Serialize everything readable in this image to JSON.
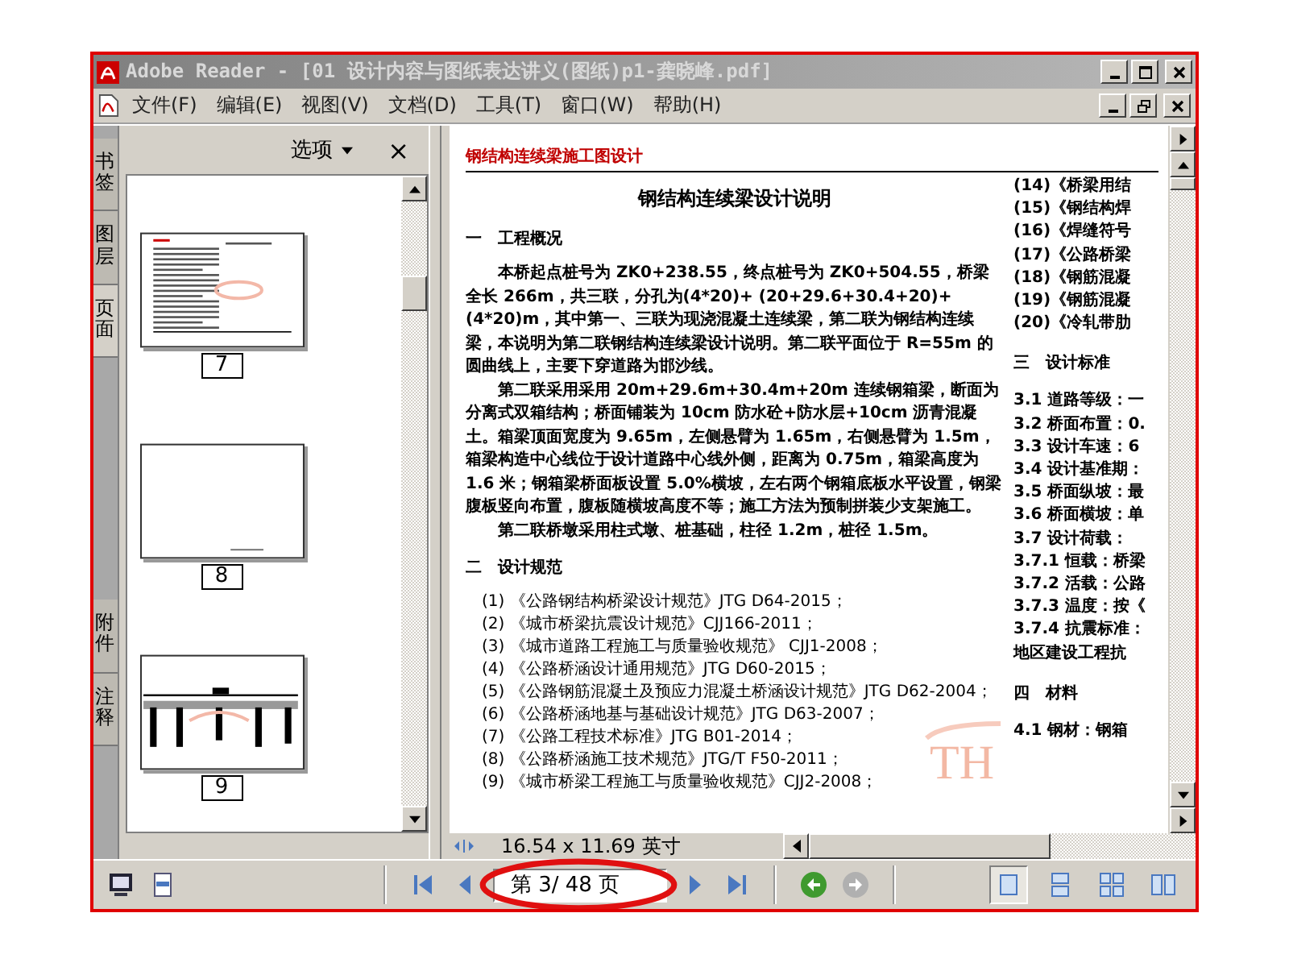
{
  "window": {
    "title": "Adobe Reader - [01 设计内容与图纸表达讲义(图纸)p1-龚晓峰.pdf]"
  },
  "menu": [
    "文件(F)",
    "编辑(E)",
    "视图(V)",
    "文档(D)",
    "工具(T)",
    "窗口(W)",
    "帮助(H)"
  ],
  "side_tabs": [
    {
      "label": "书签",
      "selected": false
    },
    {
      "label": "图层",
      "selected": false
    },
    {
      "label": "页面",
      "selected": true
    },
    {
      "label": "附件",
      "selected": false
    },
    {
      "label": "注释",
      "selected": false
    }
  ],
  "panel": {
    "options": "选项",
    "close": "×"
  },
  "thumbnails": [
    {
      "page": "7",
      "kind": "text"
    },
    {
      "page": "8",
      "kind": "blank"
    },
    {
      "page": "9",
      "kind": "drawing"
    }
  ],
  "document": {
    "header": "钢结构连续梁施工图设计",
    "title": "钢结构连续梁设计说明",
    "logo_text": "TH",
    "left_column": [
      {
        "kind": "heading",
        "text": "一　工程概况"
      },
      {
        "kind": "paragraph",
        "text": "本桥起点桩号为 ZK0+238.55，终点桩号为 ZK0+504.55，桥梁全长 266m，共三联，分孔为(4*20)+ (20+29.6+30.4+20)+(4*20)m，其中第一、三联为现浇混凝土连续梁，第二联为钢结构连续梁，本说明为第二联钢结构连续梁设计说明。第二联平面位于 R=55m 的圆曲线上，主要下穿道路为邯沙线。"
      },
      {
        "kind": "paragraph",
        "text": "第二联采用采用 20m+29.6m+30.4m+20m 连续钢箱梁，断面为分离式双箱结构；桥面铺装为 10cm 防水砼+防水层+10cm 沥青混凝土。箱梁顶面宽度为 9.65m，左侧悬臂为 1.65m，右侧悬臂为 1.5m，箱梁构造中心线位于设计道路中心线外侧，距离为 0.75m，箱梁高度为 1.6 米；钢箱梁桥面板设置 5.0%横坡，左右两个钢箱底板水平设置，钢梁腹板竖向布置，腹板随横坡高度不等；施工方法为预制拼装少支架施工。"
      },
      {
        "kind": "paragraph",
        "text": "第二联桥墩采用柱式墩、桩基础，柱径 1.2m，桩径 1.5m。"
      },
      {
        "kind": "heading",
        "text": "二　设计规范"
      },
      {
        "kind": "item",
        "text": "(1) 《公路钢结构桥梁设计规范》JTG D64-2015；"
      },
      {
        "kind": "item",
        "text": "(2) 《城市桥梁抗震设计规范》CJJ166-2011；"
      },
      {
        "kind": "item",
        "text": "(3) 《城市道路工程施工与质量验收规范》 CJJ1-2008；"
      },
      {
        "kind": "item",
        "text": "(4) 《公路桥涵设计通用规范》JTG D60-2015；"
      },
      {
        "kind": "item",
        "text": "(5) 《公路钢筋混凝土及预应力混凝土桥涵设计规范》JTG D62-2004；"
      },
      {
        "kind": "item",
        "text": "(6) 《公路桥涵地基与基础设计规范》JTG D63-2007；"
      },
      {
        "kind": "item",
        "text": "(7) 《公路工程技术标准》JTG B01-2014；"
      },
      {
        "kind": "item",
        "text": "(8) 《公路桥涵施工技术规范》JTG/T F50-2011；"
      },
      {
        "kind": "item",
        "text": "(9) 《城市桥梁工程施工与质量验收规范》CJJ2-2008；"
      }
    ],
    "right_column": [
      {
        "kind": "item",
        "text": "(14)《桥梁用结"
      },
      {
        "kind": "item",
        "text": "(15)《钢结构焊"
      },
      {
        "kind": "item",
        "text": "(16)《焊缝符号"
      },
      {
        "kind": "item",
        "text": "(17)《公路桥梁"
      },
      {
        "kind": "item",
        "text": "(18)《钢筋混凝"
      },
      {
        "kind": "item",
        "text": "(19)《钢筋混凝"
      },
      {
        "kind": "item",
        "text": "(20)《冷轧带肋"
      },
      {
        "kind": "heading",
        "text": "三　设计标准"
      },
      {
        "kind": "item",
        "text": "3.1 道路等级：一"
      },
      {
        "kind": "item",
        "text": "3.2 桥面布置：0."
      },
      {
        "kind": "item",
        "text": "3.3 设计车速：6"
      },
      {
        "kind": "item",
        "text": "3.4 设计基准期："
      },
      {
        "kind": "item",
        "text": "3.5 桥面纵坡：最"
      },
      {
        "kind": "item",
        "text": "3.6 桥面横坡：单"
      },
      {
        "kind": "item",
        "text": "3.7 设计荷载："
      },
      {
        "kind": "item",
        "text": "3.7.1 恒载：桥梁"
      },
      {
        "kind": "item",
        "text": "3.7.2 活载：公路"
      },
      {
        "kind": "item",
        "text": "3.7.3 温度：按《"
      },
      {
        "kind": "item",
        "text": "3.7.4 抗震标准："
      },
      {
        "kind": "item",
        "text": "地区建设工程抗"
      },
      {
        "kind": "heading",
        "text": "四　材料"
      },
      {
        "kind": "item",
        "text": "4.1 钢材：钢箱"
      }
    ]
  },
  "status": {
    "page_size": "16.54 x 11.69 英寸"
  },
  "toolbar": {
    "page_field": "第 3/ 48 页",
    "back_disabled": false,
    "forward_disabled": true,
    "layouts": [
      {
        "kind": "single",
        "selected": true
      },
      {
        "kind": "continuous",
        "selected": false
      },
      {
        "kind": "facing-continuous",
        "selected": false
      },
      {
        "kind": "facing",
        "selected": false
      }
    ]
  }
}
